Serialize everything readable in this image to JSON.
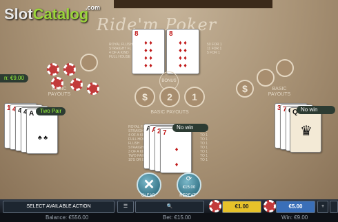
{
  "brand": {
    "slot": "Slot",
    "catalog": "Catalog",
    "com": ".com"
  },
  "title": "Ride'm Poker",
  "dealer_cards": [
    {
      "rank": "8",
      "suit": "♦"
    },
    {
      "rank": "8",
      "suit": "♦"
    }
  ],
  "center_paytable_head": "ROYAL FLUSH\nSTRAIGHT FL\n4 OF A KIND\nFULL HOUSE",
  "center_paytable_right": "50 FOR 1\n11 FOR 1\n5 FOR 1",
  "bonus_label": "BONUS",
  "bet_spots": [
    "$",
    "2",
    "1"
  ],
  "left_bet_amount": "n: €9.00",
  "basic_payouts": "BASIC PAYOUTS",
  "player_left": {
    "result": "Two Pair",
    "cards": [
      {
        "rank": "10",
        "suit": "♣"
      },
      {
        "rank": "4",
        "suit": "♠"
      },
      {
        "rank": "4",
        "suit": "♣"
      },
      {
        "rank": "4",
        "suit": "♠"
      },
      {
        "rank": "A",
        "suit": "♠"
      }
    ]
  },
  "player_center": {
    "result": "No win",
    "cards": [
      {
        "rank": "A",
        "suit": "♠"
      },
      {
        "rank": "A",
        "suit": "♦"
      },
      {
        "rank": "2",
        "suit": "♦"
      },
      {
        "rank": "7",
        "suit": "♦"
      }
    ]
  },
  "player_right": {
    "result": "No win",
    "cards": [
      {
        "rank": "3",
        "suit": "♥"
      },
      {
        "rank": "7",
        "suit": "♦"
      },
      {
        "rank": "Q",
        "suit": "♣"
      },
      {
        "rank": "Q",
        "suit": "♠"
      }
    ]
  },
  "center_paytable_rows": "ROYAL FLUSH\nSTRAIGHT FL\n4 OF A KIND\nFULL HOUSE\nFLUSH\nSTRAIGHT\n3 OF A KIND\nTWO PAIR\n10'S OR BETTER",
  "center_paytable_payouts": "TO 1\nTO 1\nTO 1\nTO 1\nTO 1\nTO 1\nTO 1\nTO 1\nTO 1",
  "actions": {
    "clear_label": "CLEAR",
    "repeat_label": "REPEAT",
    "repeat_value": "€15.00"
  },
  "toolbar": {
    "select_action": "SELECT AVAILABLE ACTION",
    "chip1_value": "€1.00",
    "chip2_value": "€5.00"
  },
  "status": {
    "balance": "Balance: €556.00",
    "bet": "Bet: €15.00",
    "win": "Win: €9.00"
  }
}
